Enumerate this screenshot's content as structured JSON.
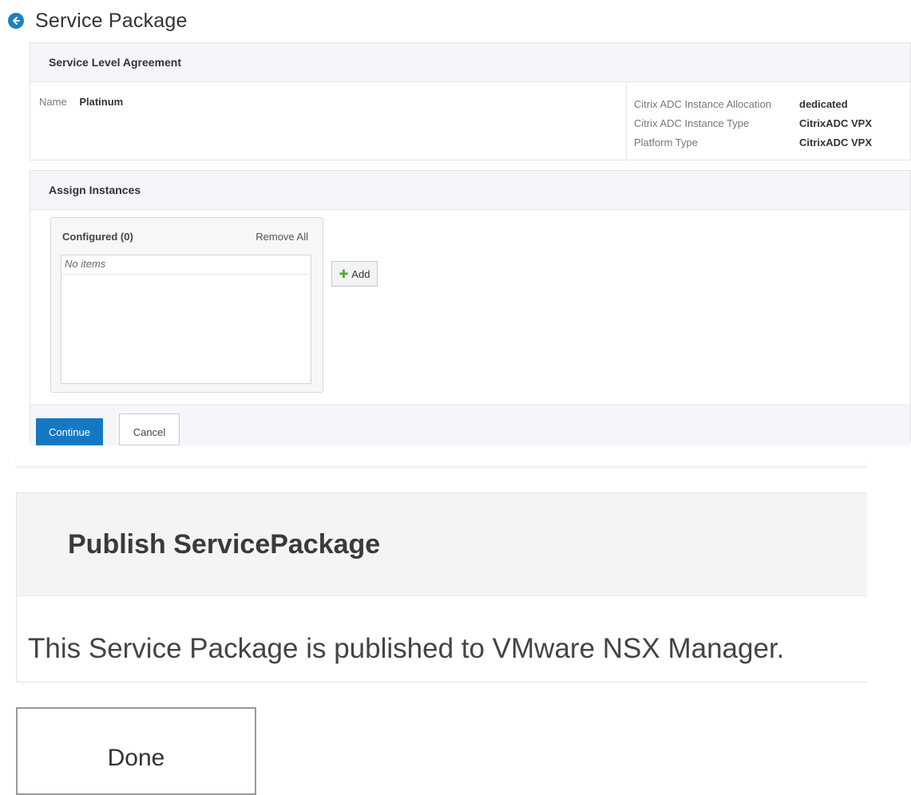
{
  "header": {
    "title": "Service Package",
    "back_icon": "arrow-left-circle-icon"
  },
  "sla": {
    "section_title": "Service Level Agreement",
    "name_label": "Name",
    "name_value": "Platinum",
    "details": [
      {
        "label": "Citrix ADC Instance Allocation",
        "value": "dedicated"
      },
      {
        "label": "Citrix ADC Instance Type",
        "value": "CitrixADC VPX"
      },
      {
        "label": "Platform Type",
        "value": "CitrixADC VPX"
      }
    ]
  },
  "assign": {
    "section_title": "Assign Instances",
    "configured_title": "Configured (0)",
    "remove_all": "Remove All",
    "empty_text": "No items",
    "add_label": "Add",
    "continue_label": "Continue",
    "cancel_label": "Cancel"
  },
  "publish": {
    "title": "Publish ServicePackage",
    "message": "This Service Package is published to VMware NSX Manager.",
    "done_label": "Done"
  },
  "colors": {
    "accent": "#1479c4",
    "back_icon": "#1f7fc1",
    "add_plus": "#4caf2a"
  }
}
